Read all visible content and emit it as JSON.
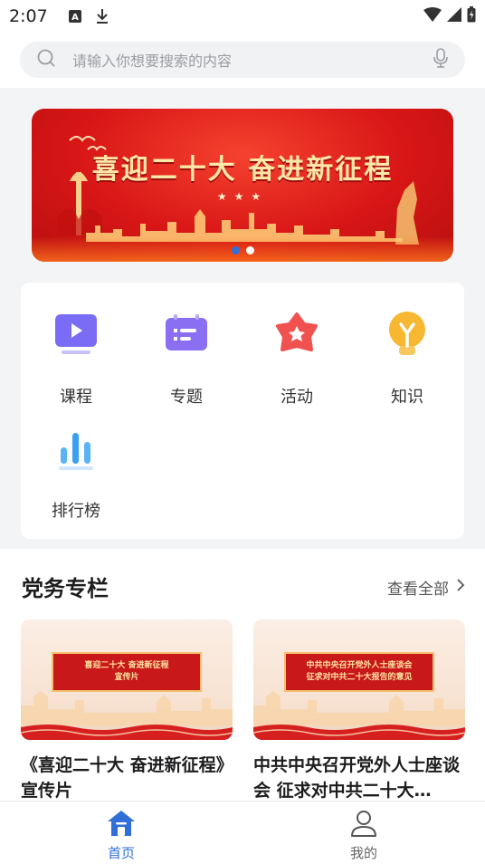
{
  "status_bar": {
    "time": "2:07"
  },
  "search": {
    "placeholder": "请输入你想要搜索的内容",
    "icon": "search-icon",
    "voice_icon": "microphone-icon"
  },
  "banner": {
    "title": "喜迎二十大  奋进新征程",
    "stars": "★★★",
    "page_count": 2,
    "active_index": 0
  },
  "menu": {
    "items": [
      {
        "label": "课程",
        "icon": "video-play-icon",
        "color": "#7b6cf6"
      },
      {
        "label": "专题",
        "icon": "topic-list-icon",
        "color": "#8a6ff2"
      },
      {
        "label": "活动",
        "icon": "star-badge-icon",
        "color": "#f0524f"
      },
      {
        "label": "知识",
        "icon": "lightbulb-icon",
        "color": "#f7b731"
      },
      {
        "label": "排行榜",
        "icon": "bar-chart-icon",
        "color": "#3aa0f2"
      }
    ]
  },
  "party_section": {
    "title": "党务专栏",
    "more_label": "查看全部",
    "cards": [
      {
        "title": "《喜迎二十大 奋进新征程》宣传片",
        "image_lines": [
          "喜迎二十大 奋进新征程",
          "宣传片"
        ]
      },
      {
        "title": "中共中央召开党外人士座谈会 征求对中共二十大…",
        "image_lines": [
          "中共中央召开党外人士座谈会",
          "征求对中共二十大报告的意见"
        ]
      }
    ]
  },
  "tabbar": {
    "tabs": [
      {
        "label": "首页",
        "icon": "home-icon",
        "active": true
      },
      {
        "label": "我的",
        "icon": "user-icon",
        "active": false
      }
    ]
  },
  "colors": {
    "accent": "#2f6fd6",
    "banner_red": "#d81616"
  }
}
